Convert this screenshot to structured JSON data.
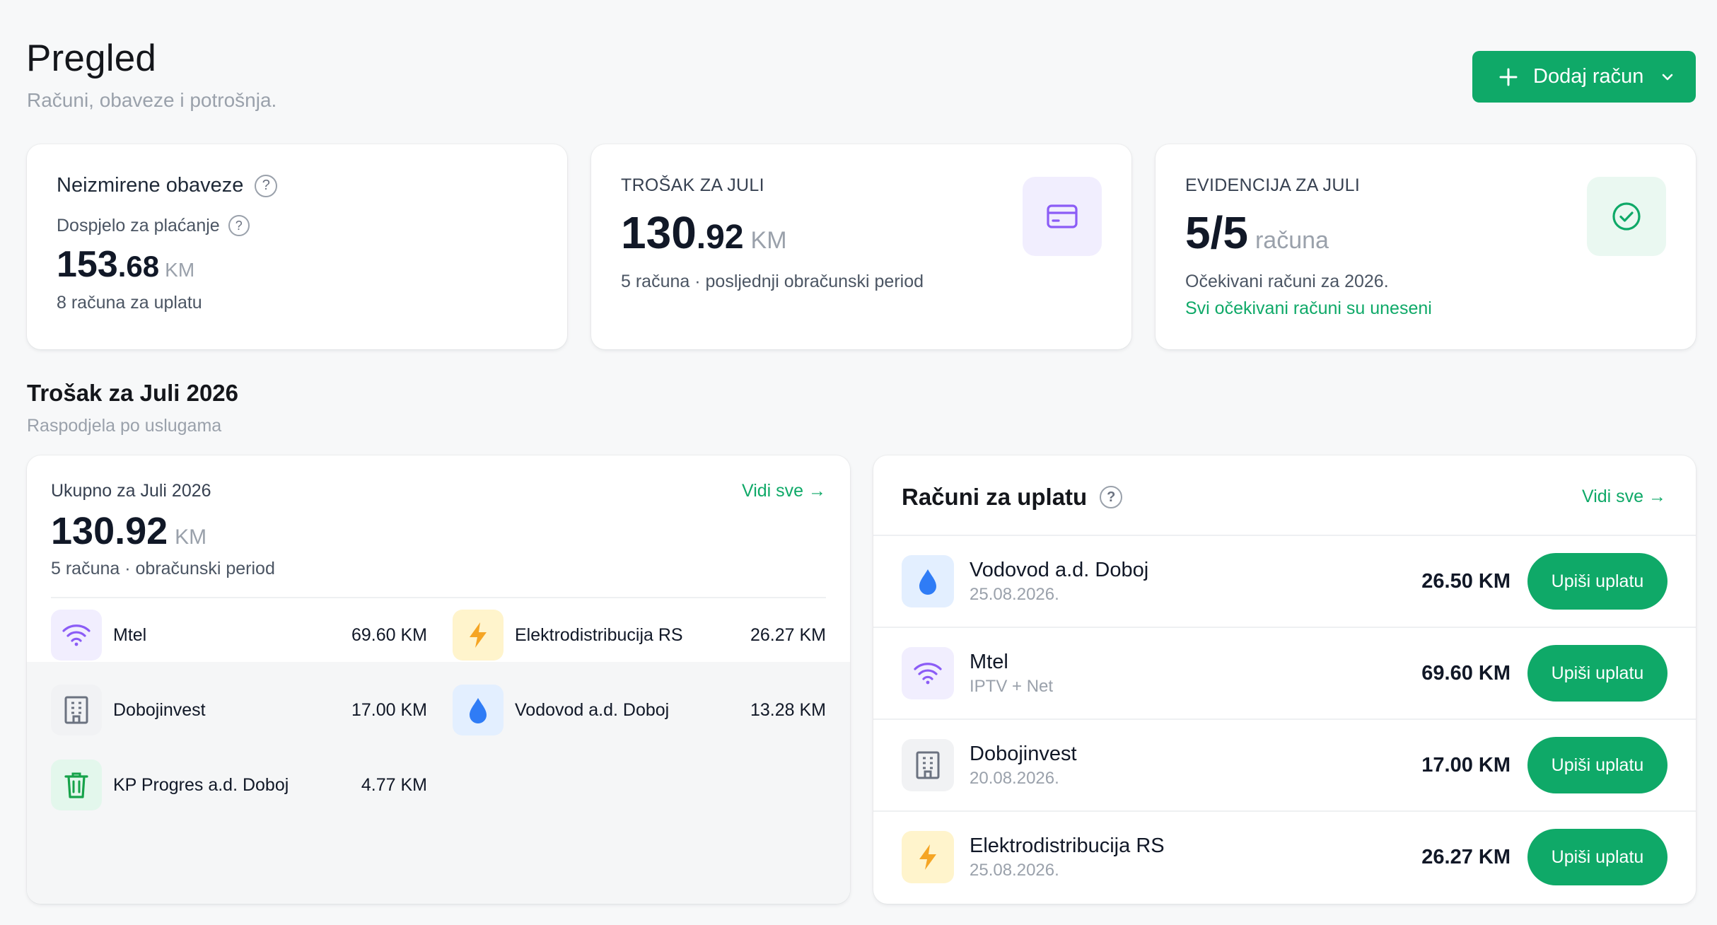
{
  "header": {
    "title": "Pregled",
    "subtitle": "Računi, obaveze i potrošnja.",
    "add_button_label": "Dodaj račun"
  },
  "kpi": {
    "outstanding": {
      "title": "Neizmirene obaveze",
      "due_label": "Dospjelo za plaćanje",
      "amount_int": "153",
      "amount_dec": ".68",
      "currency": "KM",
      "count_text": "8 računa za uplatu"
    },
    "cost": {
      "label": "TROŠAK ZA JULI",
      "amount_int": "130",
      "amount_dec": ".92",
      "currency": "KM",
      "sub": "5 računa · posljednji obračunski period"
    },
    "records": {
      "label": "EVIDENCIJA ZA JULI",
      "value": "5/5",
      "unit": "računa",
      "sub": "Očekivani računi za 2026.",
      "status": "Svi očekivani računi su uneseni"
    }
  },
  "section": {
    "title": "Trošak za Juli 2026",
    "subtitle": "Raspodjela po uslugama"
  },
  "breakdown": {
    "label": "Ukupno za Juli 2026",
    "link": "Vidi sve →",
    "amount": "130.92",
    "currency": "KM",
    "sub": "5 računa · obračunski period",
    "items": [
      {
        "name": "Mtel",
        "value": "69.60 KM",
        "icon": "wifi-icon"
      },
      {
        "name": "Elektrodistribucija RS",
        "value": "26.27 KM",
        "icon": "lightning-icon"
      },
      {
        "name": "Dobojinvest",
        "value": "17.00 KM",
        "icon": "building-icon"
      },
      {
        "name": "Vodovod a.d. Doboj",
        "value": "13.28 KM",
        "icon": "water-drop-icon"
      },
      {
        "name": "KP Progres a.d. Doboj",
        "value": "4.77 KM",
        "icon": "trash-icon"
      }
    ]
  },
  "bills": {
    "title": "Računi za uplatu",
    "link": "Vidi sve →",
    "pay_label": "Upiši uplatu",
    "items": [
      {
        "name": "Vodovod a.d. Doboj",
        "detail": "25.08.2026.",
        "amount": "26.50 KM",
        "icon": "water-drop-icon"
      },
      {
        "name": "Mtel",
        "detail": "IPTV + Net",
        "amount": "69.60 KM",
        "icon": "wifi-icon"
      },
      {
        "name": "Dobojinvest",
        "detail": "20.08.2026.",
        "amount": "17.00 KM",
        "icon": "building-icon"
      },
      {
        "name": "Elektrodistribucija RS",
        "detail": "25.08.2026.",
        "amount": "26.27 KM",
        "icon": "lightning-icon"
      }
    ]
  },
  "colors": {
    "accent": "#0fa968",
    "purple": "#8b5cf6",
    "yellow": "#f5a524",
    "blue": "#2f7cf6",
    "grey_icon": "#6b7280"
  }
}
